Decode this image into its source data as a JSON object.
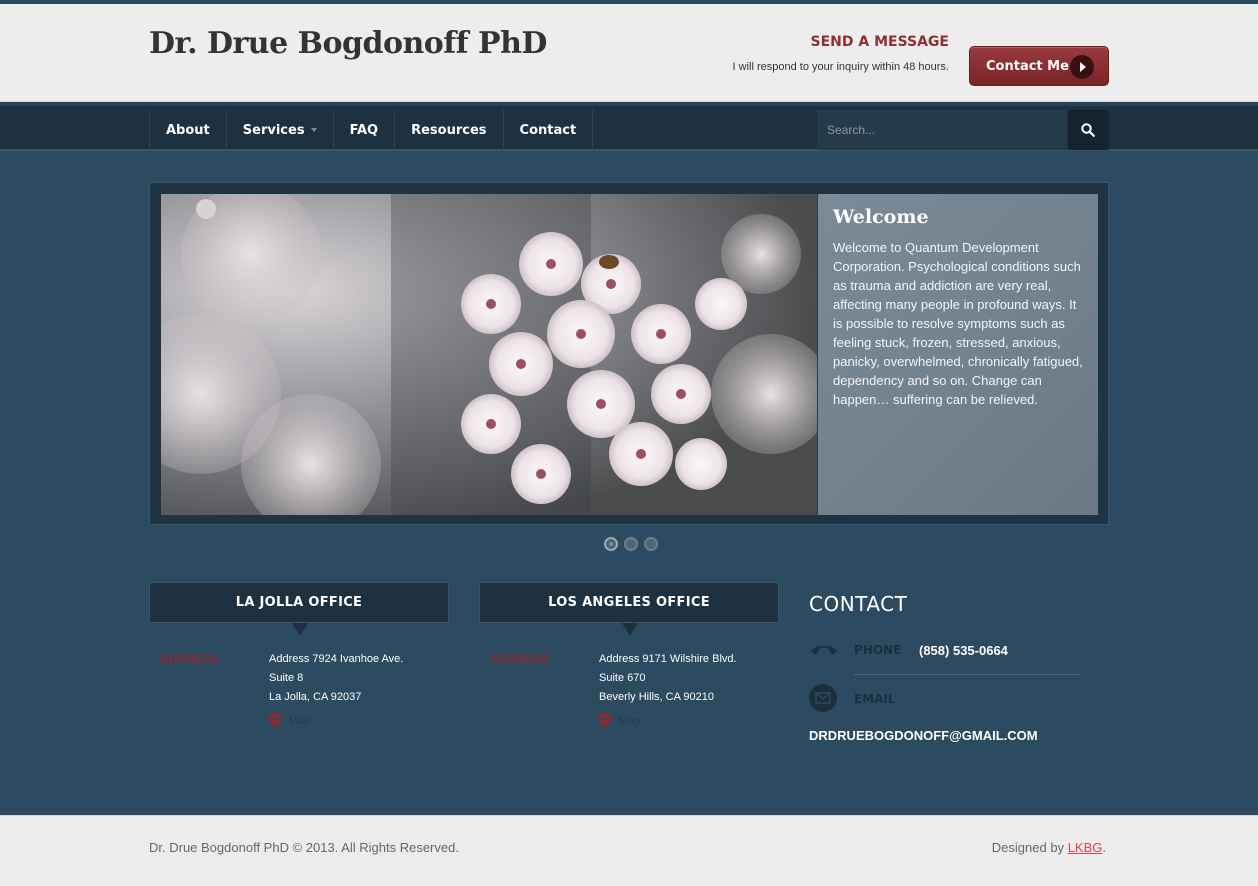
{
  "header": {
    "site_title": "Dr. Drue Bogdonoff PhD",
    "send_message": "SEND A MESSAGE",
    "respond_text": "I will respond to your inquiry within 48 hours.",
    "contact_button": "Contact Me"
  },
  "nav": {
    "items": [
      {
        "label": "About"
      },
      {
        "label": "Services"
      },
      {
        "label": "FAQ"
      },
      {
        "label": "Resources"
      },
      {
        "label": "Contact"
      }
    ],
    "search_placeholder": "Search..."
  },
  "slider": {
    "title": "Welcome",
    "text": "Welcome to Quantum Development Corporation. Psychological conditions such as trauma and addiction are very real, affecting many people in profound ways. It is possible to resolve symptoms such as feeling stuck, frozen, stressed, anxious, panicky, overwhelmed, chronically fatigued, dependency and so on. Change can happen… suffering can be relieved.",
    "dots": 3,
    "active_dot": 1
  },
  "offices": [
    {
      "title": "LA JOLLA OFFICE",
      "address_label": "ADDRESS",
      "lines": [
        "Address 7924 Ivanhoe Ave.",
        "Suite 8",
        "La Jolla, CA 92037"
      ],
      "map_label": "Map"
    },
    {
      "title": "LOS ANGELES OFFICE",
      "address_label": "ADDRESS",
      "lines": [
        "Address 9171 Wilshire Blvd.",
        "Suite 670",
        "Beverly Hills, CA 90210"
      ],
      "map_label": "Map"
    }
  ],
  "contact": {
    "title": "CONTACT",
    "phone_label": "PHONE",
    "phone": "(858) 535-0664",
    "email_label": "EMAIL",
    "email": "DRDRUEBOGDONOFF@GMAIL.COM"
  },
  "footer": {
    "copyright": "Dr. Drue Bogdonoff PhD © 2013. All Rights Reserved.",
    "designed_by": "Designed by",
    "designer": "LKBG",
    "period": "."
  },
  "colors": {
    "accent_red": "#8e2f35",
    "nav_bg": "#1d3140",
    "body_bg": "#2c4a60"
  }
}
